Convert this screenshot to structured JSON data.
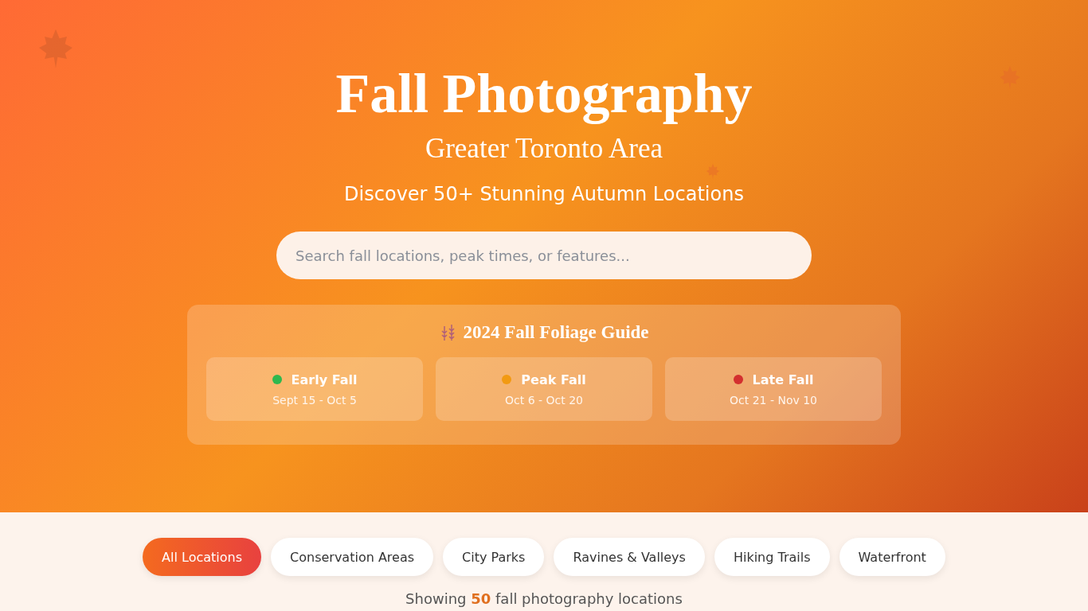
{
  "hero": {
    "title": "Fall Photography",
    "subtitle": "Greater Toronto Area",
    "tagline": "Discover 50+ Stunning Autumn Locations",
    "search": {
      "placeholder": "Search fall locations, peak times, or features..."
    },
    "guide": {
      "title": "2024 Fall Foliage Guide",
      "phases": [
        {
          "name": "Early Fall",
          "dates": "Sept 15 - Oct 5",
          "color": "#2fb84f"
        },
        {
          "name": "Peak Fall",
          "dates": "Oct 6 - Oct 20",
          "color": "#f29a12"
        },
        {
          "name": "Late Fall",
          "dates": "Oct 21 - Nov 10",
          "color": "#d32f2f"
        }
      ]
    }
  },
  "filters": [
    {
      "label": "All Locations",
      "selected": true
    },
    {
      "label": "Conservation Areas",
      "selected": false
    },
    {
      "label": "City Parks",
      "selected": false
    },
    {
      "label": "Ravines & Valleys",
      "selected": false
    },
    {
      "label": "Hiking Trails",
      "selected": false
    },
    {
      "label": "Waterfront",
      "selected": false
    }
  ],
  "results": "Showing **50** fall photography locations"
}
